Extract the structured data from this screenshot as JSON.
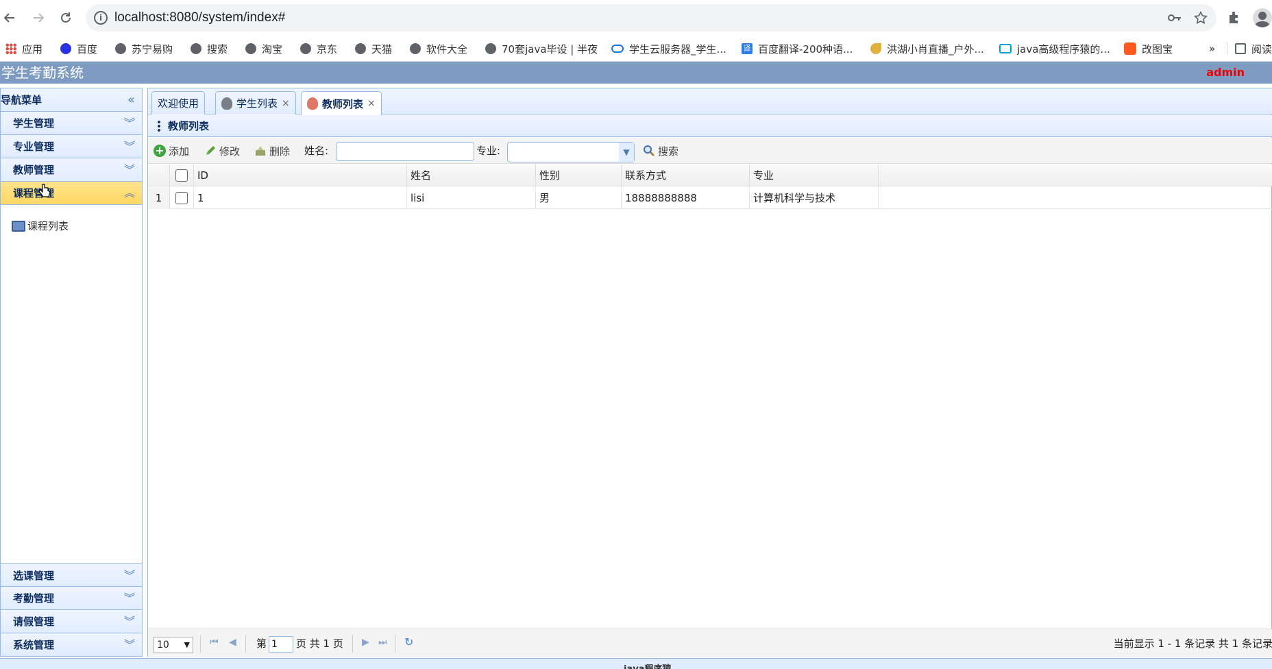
{
  "browser": {
    "url": "localhost:8080/system/index#",
    "bookmarks": [
      {
        "label": "应用",
        "icon": "apps-grid-icon"
      },
      {
        "label": "百度",
        "icon": "baidu-paw-icon"
      },
      {
        "label": "苏宁易购",
        "icon": "globe-icon"
      },
      {
        "label": "搜索",
        "icon": "globe-icon"
      },
      {
        "label": "淘宝",
        "icon": "globe-icon"
      },
      {
        "label": "京东",
        "icon": "globe-icon"
      },
      {
        "label": "天猫",
        "icon": "globe-icon"
      },
      {
        "label": "软件大全",
        "icon": "globe-icon"
      },
      {
        "label": "70套java毕设 | 半夜",
        "icon": "globe-icon"
      },
      {
        "label": "学生云服务器_学生...",
        "icon": "cloud-icon"
      },
      {
        "label": "百度翻译-200种语...",
        "icon": "translate-icon"
      },
      {
        "label": "洪湖小肖直播_户外...",
        "icon": "bird-icon"
      },
      {
        "label": "java高级程序猿的...",
        "icon": "tv-icon"
      },
      {
        "label": "改图宝",
        "icon": "orange-square-icon"
      },
      {
        "label": "阅读",
        "icon": "reading-list-icon"
      }
    ],
    "more": "»"
  },
  "app": {
    "title": "学生考勤系统",
    "user": "admin"
  },
  "sidebar": {
    "title": "导航菜单",
    "top_items": [
      {
        "label": "学生管理"
      },
      {
        "label": "专业管理"
      },
      {
        "label": "教师管理"
      },
      {
        "label": "课程管理"
      }
    ],
    "sub_item": "课程列表",
    "bottom_items": [
      {
        "label": "选课管理"
      },
      {
        "label": "考勤管理"
      },
      {
        "label": "请假管理"
      },
      {
        "label": "系统管理"
      }
    ]
  },
  "tabs": [
    {
      "label": "欢迎使用"
    },
    {
      "label": "学生列表",
      "close": "×"
    },
    {
      "label": "教师列表",
      "close": "×"
    }
  ],
  "panel": {
    "title": "教师列表"
  },
  "toolbar": {
    "add": "添加",
    "edit": "修改",
    "delete": "删除",
    "name_label": "姓名:",
    "name_value": "",
    "major_label": "专业:",
    "major_value": "",
    "search": "搜索"
  },
  "grid": {
    "columns": [
      "ID",
      "姓名",
      "性别",
      "联系方式",
      "专业"
    ],
    "rows": [
      {
        "num": "1",
        "id": "1",
        "name": "lisi",
        "gender": "男",
        "phone": "18888888888",
        "major": "计算机科学与技术"
      }
    ]
  },
  "pager": {
    "page_size": "10",
    "page_prefix": "第",
    "page_value": "1",
    "page_suffix": "页 共 1 页",
    "info": "当前显示 1 - 1 条记录 共 1 条记录"
  },
  "footer": {
    "text": "java程序猿"
  }
}
